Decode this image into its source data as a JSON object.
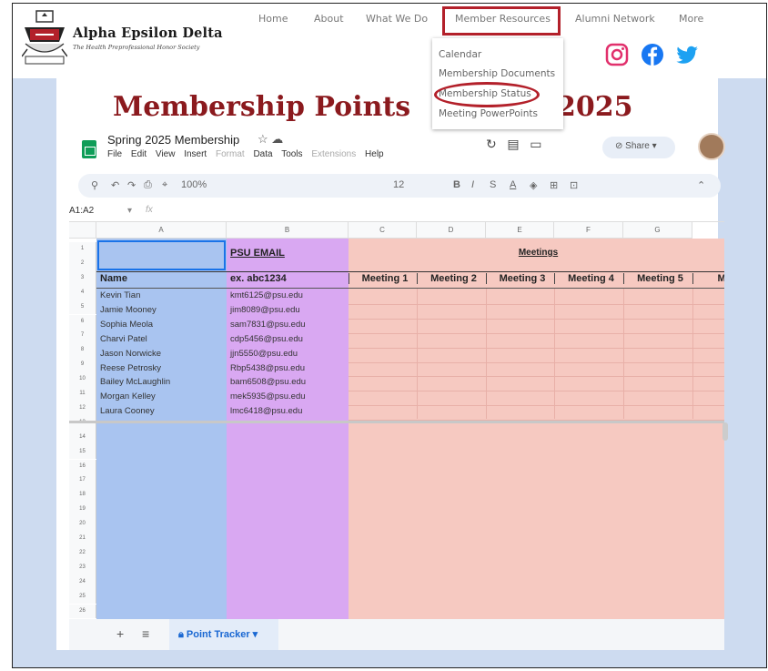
{
  "site": {
    "brand_title": "Alpha Epsilon Delta",
    "brand_subtitle": "The Health Preprofessional Honor Society"
  },
  "nav": {
    "items": [
      "Home",
      "About",
      "What We Do",
      "Member Resources",
      "Alumni Network",
      "More"
    ],
    "dropdown": [
      "Calendar",
      "Membership Documents",
      "Membership Status",
      "Meeting PowerPoints"
    ]
  },
  "social": {
    "icons": [
      "instagram-icon",
      "facebook-icon",
      "twitter-icon"
    ],
    "colors": {
      "instagram": "#e1306c",
      "facebook": "#1877f2",
      "twitter": "#1da1f2"
    }
  },
  "page": {
    "title_left": "Membership Points",
    "title_right": "2025"
  },
  "sheet": {
    "doc_title": "Spring 2025 Membership",
    "menus": [
      "File",
      "Edit",
      "View",
      "Insert",
      "Format",
      "Data",
      "Tools",
      "Extensions",
      "Help"
    ],
    "share_label": "Share",
    "zoom": "100%",
    "font_size": "12",
    "cell_ref": "A1:A2",
    "fx": "fx",
    "columns": [
      "A",
      "B",
      "C",
      "D",
      "E",
      "F",
      "G"
    ],
    "email_header": "PSU EMAIL",
    "meetings_header": "Meetings",
    "name_label": "Name",
    "email_example": "ex. abc1234",
    "meeting_cols": [
      "Meeting 1",
      "Meeting 2",
      "Meeting 3",
      "Meeting 4",
      "Meeting 5",
      "Meet"
    ],
    "rows": [
      {
        "name": "Kevin Tian",
        "email": "kmt6125@psu.edu"
      },
      {
        "name": "Jamie Mooney",
        "email": "jim8089@psu.edu"
      },
      {
        "name": "Sophia Meola",
        "email": "sam7831@psu.edu"
      },
      {
        "name": "Charvi Patel",
        "email": "cdp5456@psu.edu"
      },
      {
        "name": "Jason Norwicke",
        "email": "jjn5550@psu.edu"
      },
      {
        "name": "Reese Petrosky",
        "email": "Rbp5438@psu.edu"
      },
      {
        "name": "Bailey McLaughlin",
        "email": "bam6508@psu.edu"
      },
      {
        "name": "Morgan Kelley",
        "email": "mek5935@psu.edu"
      },
      {
        "name": "Laura Cooney",
        "email": "lmc6418@psu.edu"
      }
    ],
    "row_numbers": [
      "1",
      "2",
      "3",
      "4",
      "5",
      "6",
      "7",
      "8",
      "9",
      "10",
      "11",
      "12",
      "13",
      "14",
      "15",
      "16",
      "17",
      "18",
      "19",
      "20",
      "21",
      "22",
      "23",
      "24",
      "25",
      "26"
    ],
    "tab_name": "Point Tracker",
    "colors": {
      "col_a": "#a9c4f0",
      "col_b": "#d9a8f2",
      "meetings": "#f6c9c1",
      "brand_red": "#8b1a1e"
    }
  }
}
